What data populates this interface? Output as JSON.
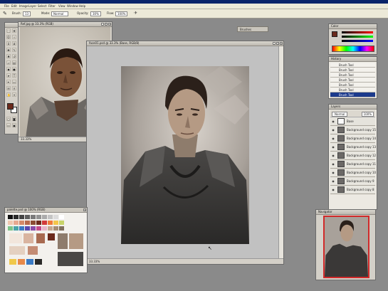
{
  "menubar": {
    "items": [
      "File",
      "Edit",
      "Image",
      "Layer",
      "Select",
      "Filter",
      "View",
      "Window",
      "Help"
    ]
  },
  "options_bar": {
    "tool_glyph": "brush-icon",
    "brush_label": "Brush:",
    "brush_size": "13",
    "mode_label": "Mode:",
    "mode_value": "Normal",
    "opacity_label": "Opacity:",
    "opacity_value": "30%",
    "flow_label": "Flow:",
    "flow_value": "100%"
  },
  "palette_well": {
    "label": "Brushes"
  },
  "reference_window": {
    "title": "Ref.jpg @ 33.3% (RGB)",
    "status": "33.33%"
  },
  "main_document": {
    "title": "face01.psd @ 33.3% (Base, RGB/8)",
    "status_zoom": "33.33%"
  },
  "color_palette_window": {
    "title": "palette.psd @ 100% (RGB)"
  },
  "navigator_panel": {
    "tabs": [
      "Color",
      "Swatches",
      "Styles"
    ]
  },
  "history_panel": {
    "tabs": [
      "History",
      "Actions"
    ],
    "items": [
      "Brush Tool",
      "Brush Tool",
      "Brush Tool",
      "Brush Tool",
      "Brush Tool",
      "Brush Tool",
      "Brush Tool"
    ],
    "active_index": 6
  },
  "layers_panel": {
    "tabs": [
      "Layers",
      "Channels",
      "Paths"
    ],
    "blend": "Normal",
    "opacity": "100%",
    "layers": [
      "Base",
      "Background copy 15",
      "Background copy 14",
      "Background copy 13",
      "Background copy 12",
      "Background copy 11",
      "Background copy 10",
      "Background copy 9",
      "Background copy 8"
    ],
    "active_index": 0
  },
  "navigator_preview": {
    "tabs": [
      "Navigator",
      "Info"
    ]
  },
  "colors": {
    "workspace": "#8a8a8a",
    "panel_bg": "#d4d0c8",
    "selection": "#1c3a8c",
    "foreground_color": "#6b2a1c",
    "background_color": "#ffffff"
  },
  "toolbox_icons": [
    "marquee-icon",
    "move-icon",
    "lasso-icon",
    "magic-wand-icon",
    "crop-icon",
    "slice-icon",
    "healing-icon",
    "brush-icon",
    "stamp-icon",
    "history-brush-icon",
    "eraser-icon",
    "gradient-icon",
    "blur-icon",
    "dodge-icon",
    "path-select-icon",
    "type-icon",
    "pen-icon",
    "shape-icon",
    "notes-icon",
    "eyedropper-icon",
    "hand-icon",
    "zoom-icon"
  ]
}
